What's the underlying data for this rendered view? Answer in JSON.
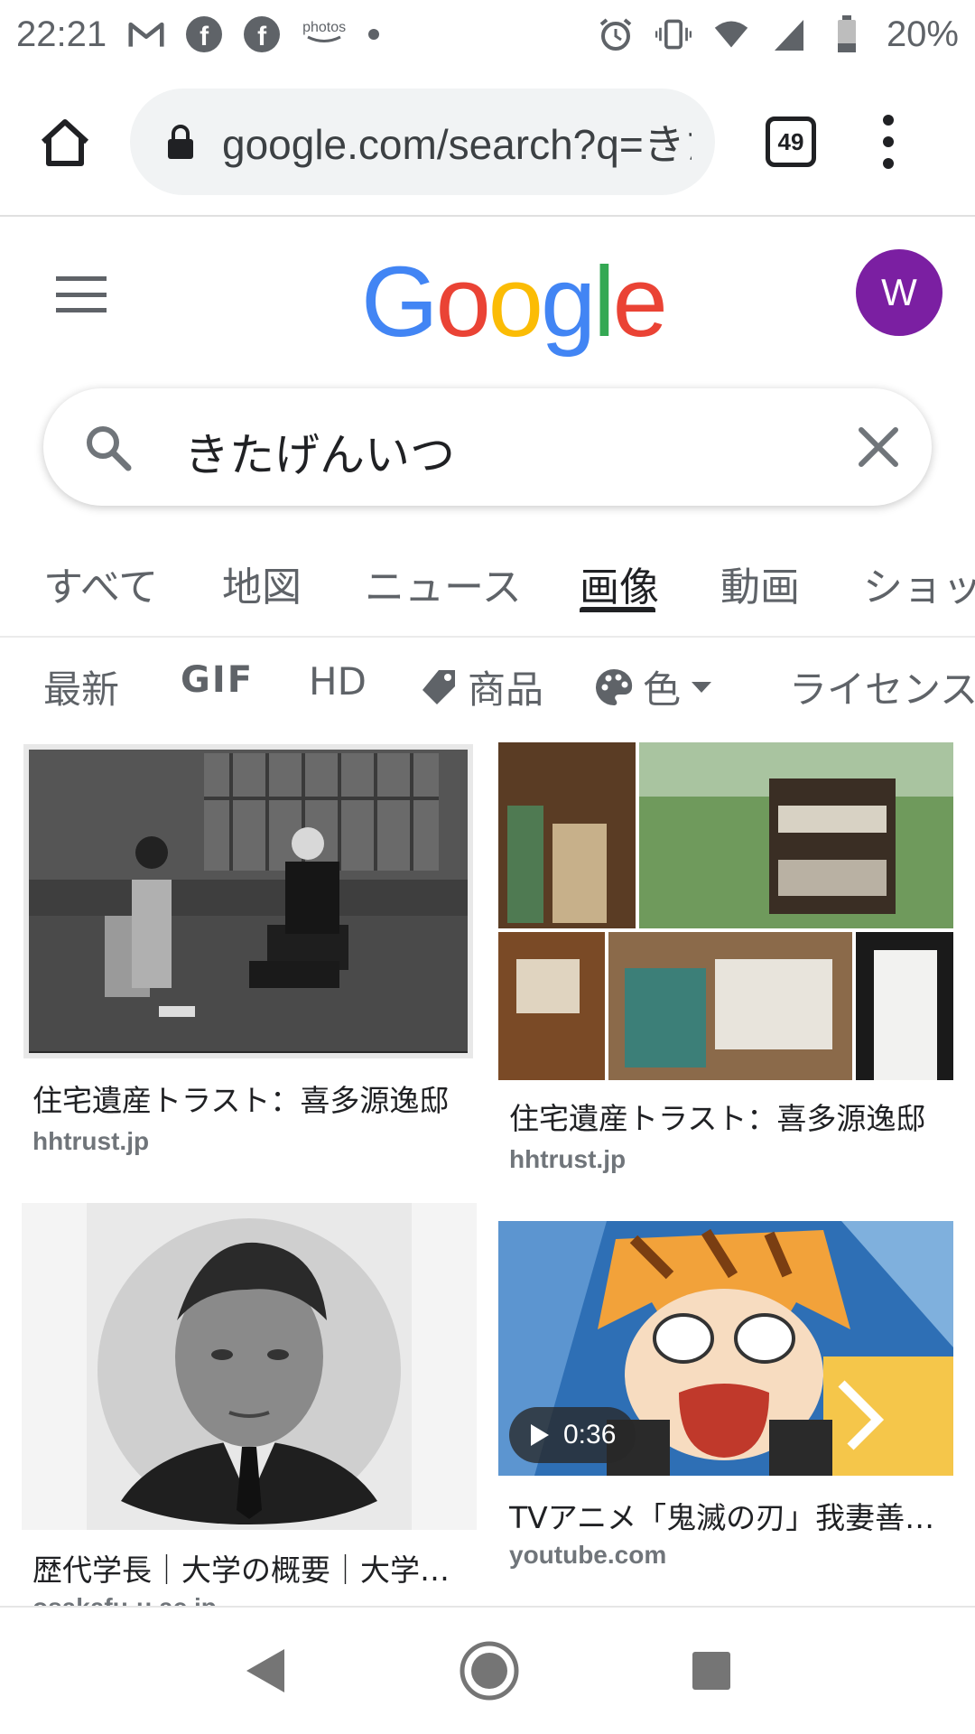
{
  "status_bar": {
    "time": "22:21",
    "notification_icons": [
      "gmail-icon",
      "facebook-icon",
      "facebook-icon",
      "amazon-photos-icon",
      "dot-icon"
    ],
    "photos_label": "photos",
    "system_icons": [
      "alarm-icon",
      "vibrate-icon",
      "wifi-icon",
      "signal-icon",
      "battery-icon"
    ],
    "battery": "20%"
  },
  "browser": {
    "url": "google.com/search?q=きたげんいつ",
    "tab_count": "49"
  },
  "google": {
    "logo": [
      "G",
      "o",
      "o",
      "g",
      "l",
      "e"
    ],
    "avatar_letter": "W",
    "avatar_color": "#7b1fa2"
  },
  "search": {
    "query": "きたげんいつ"
  },
  "tabs": [
    {
      "label": "すべて",
      "active": false
    },
    {
      "label": "地図",
      "active": false
    },
    {
      "label": "ニュース",
      "active": false
    },
    {
      "label": "画像",
      "active": true
    },
    {
      "label": "動画",
      "active": false
    },
    {
      "label": "ショッ",
      "active": false
    }
  ],
  "filters": [
    {
      "label": "最新"
    },
    {
      "label": "GIF"
    },
    {
      "label": "HD"
    },
    {
      "label": "商品",
      "icon": "tag-icon"
    },
    {
      "label": "色",
      "icon": "palette-icon"
    },
    {
      "label": "ライセンス"
    }
  ],
  "results": [
    {
      "title": "住宅遺産トラスト：喜多源逸邸",
      "source": "hhtrust.jp"
    },
    {
      "title": "住宅遺産トラスト：喜多源逸邸",
      "source": "hhtrust.jp"
    },
    {
      "title": "歴代学長｜大学の概要｜大学…",
      "source": "osakafu-u.ac.jp"
    },
    {
      "title": "TVアニメ「鬼滅の刃」我妻善…",
      "source": "youtube.com",
      "duration": "0:36"
    }
  ],
  "nav_bar": [
    "back-icon",
    "home-icon",
    "recents-icon"
  ]
}
